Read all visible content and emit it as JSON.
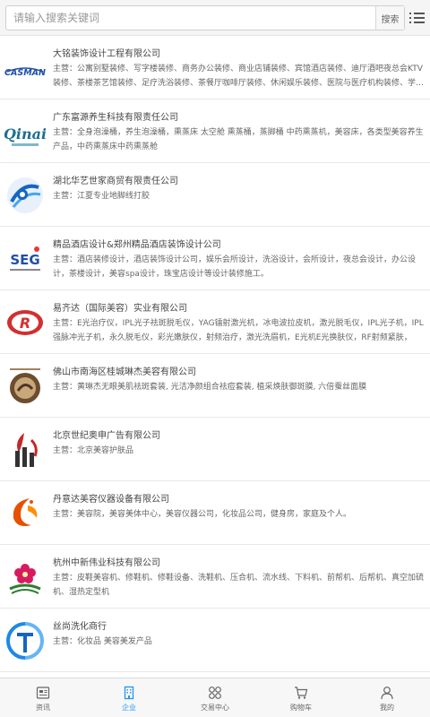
{
  "search": {
    "placeholder": "请输入搜索关键词",
    "button_label": "搜索"
  },
  "colors": {
    "accent": "#2196f3",
    "text_muted": "#666666"
  },
  "companies": [
    {
      "name": "大铭装饰设计工程有限公司",
      "desc": "主营：公寓别墅装修、写字楼装修、商务办公装修、商业店铺装修、宾馆酒店装修、迪厅酒吧夜总会KTV装修、茶楼茶艺馆装修、足疗洗浴装修、茶餐厅咖啡厅装修、休闲娱乐装修、医院与医疗机构装修、学…",
      "logo_text": "CASMAN"
    },
    {
      "name": "广东富源养生科技有限责任公司",
      "desc": "主营：全身泡澡桶，养生泡澡桶，熏蒸床 太空舱 熏蒸桶，蒸脚桶 中药熏蒸机，美容床，各类型美容养生产品，中药熏蒸床中药熏蒸舱",
      "logo_text": "Qinai"
    },
    {
      "name": "湖北华艺世家商贸有限责任公司",
      "desc": "主营：江夏专业地脚线打胶",
      "logo_text": ""
    },
    {
      "name": "精品酒店设计&郑州精品酒店装饰设计公司",
      "desc": "主营：酒店装修设计，酒店装饰设计公司，娱乐会所设计，洗浴设计，会所设计，夜总会设计，办公设计，茶楼设计，美容spa设计，珠宝店设计等设计装修施工。",
      "logo_text": "SEG"
    },
    {
      "name": "易齐达（国际美容）实业有限公司",
      "desc": "主营：E光治疗仪，IPL光子祛斑脱毛仪，YAG镭射激光机，冰电波拉皮机，激光脱毛仪，IPL光子机，IPL强脉冲光子机，永久脱毛仪，彩光嫩肤仪，射频治疗，激光洗眉机，E光机E光换肤仪，RF射频紧肤，E…",
      "logo_text": "R"
    },
    {
      "name": "佛山市南海区桂城琳杰美容有限公司",
      "desc": "主营：黄琳杰无眼美肌祛斑套装, 光洁净颜组合祛痘套装, 植采焕肤御斑膜, 六倍蚕丝面膜",
      "logo_text": ""
    },
    {
      "name": "北京世纪奥申广告有限公司",
      "desc": "主营：北京美容护肤品",
      "logo_text": ""
    },
    {
      "name": "丹意达美容仪器设备有限公司",
      "desc": "主营：美容院，美容美体中心，美容仪器公司，化妆品公司，健身房，家庭及个人。",
      "logo_text": ""
    },
    {
      "name": "杭州中新伟业科技有限公司",
      "desc": "主营：皮鞋美容机、修鞋机、修鞋设备、洗鞋机、压合机、流水线、下料机、前帮机、后帮机、真空加硫机、湿热定型机",
      "logo_text": ""
    },
    {
      "name": "丝尚洗化商行",
      "desc": "主营：化妆品 美容美发产品",
      "logo_text": ""
    }
  ],
  "tabs": [
    {
      "label": "资讯",
      "icon": "news-icon"
    },
    {
      "label": "企业",
      "icon": "building-icon"
    },
    {
      "label": "交易中心",
      "icon": "grid-icon"
    },
    {
      "label": "购物车",
      "icon": "cart-icon"
    },
    {
      "label": "我的",
      "icon": "user-icon"
    }
  ]
}
